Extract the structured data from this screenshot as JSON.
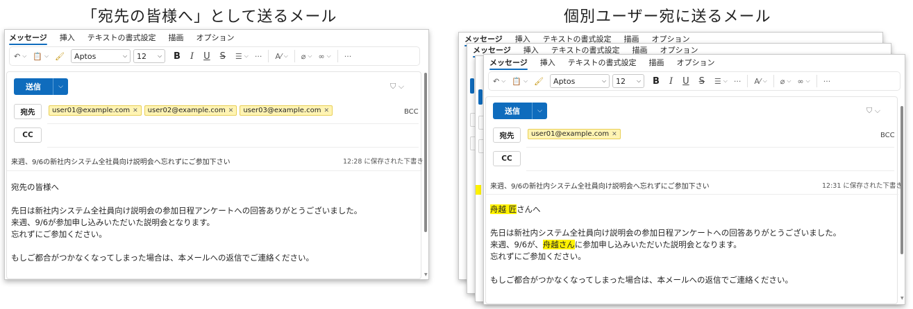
{
  "captions": {
    "left": "「宛先の皆様へ」として送るメール",
    "right": "個別ユーザー宛に送るメール"
  },
  "ribbon": {
    "tabs": [
      "メッセージ",
      "挿入",
      "テキストの書式設定",
      "描画",
      "オプション"
    ]
  },
  "toolbar": {
    "font": "Aptos",
    "size": "12",
    "bold": "B",
    "italic": "I",
    "underline": "U",
    "strike": "S",
    "more": "···"
  },
  "left_mail": {
    "send_label": "送信",
    "to_label": "宛先",
    "cc_label": "CC",
    "bcc_label": "BCC",
    "recipients": [
      "user01@example.com",
      "user02@example.com",
      "user03@example.com"
    ],
    "subject": "来週、9/6の新社内システム全社員向け説明会へ忘れずにご参加下さい",
    "saved": "12:28 に保存された下書き",
    "greeting": "宛先の皆様へ",
    "line1": "先日は新社内システム全社員向け説明会の参加日程アンケートへの回答ありがとうございました。",
    "line2": "来週、9/6が参加申し込みいただいた説明会となります。",
    "line3": "忘れずにご参加ください。",
    "line4": "もしご都合がつかなくなってしまった場合は、本メールへの返信でご連絡ください。"
  },
  "right_mail": {
    "send_label": "送信",
    "to_label": "宛先",
    "cc_label": "CC",
    "bcc_label": "BCC",
    "recipients": [
      "user01@example.com"
    ],
    "subject": "来週、9/6の新社内システム全社員向け説明会へ忘れずにご参加下さい",
    "saved": "12:31 に保存された下書き",
    "name": "舟越 匠",
    "greeting_suffix": "さんへ",
    "line1": "先日は新社内システム全社員向け説明会の参加日程アンケートへの回答ありがとうございました。",
    "line2_pre": "来週、9/6が、",
    "line2_name": "舟越さん",
    "line2_post": "に参加申し込みいただいた説明会となります。",
    "line3": "忘れずにご参加ください。",
    "line4": "もしご都合がつかなくなってしまった場合は、本メールへの返信でご連絡ください。"
  },
  "colors": {
    "accent": "#0f6cbd",
    "chip_bg": "#fff4b3",
    "highlight": "#fff200"
  }
}
